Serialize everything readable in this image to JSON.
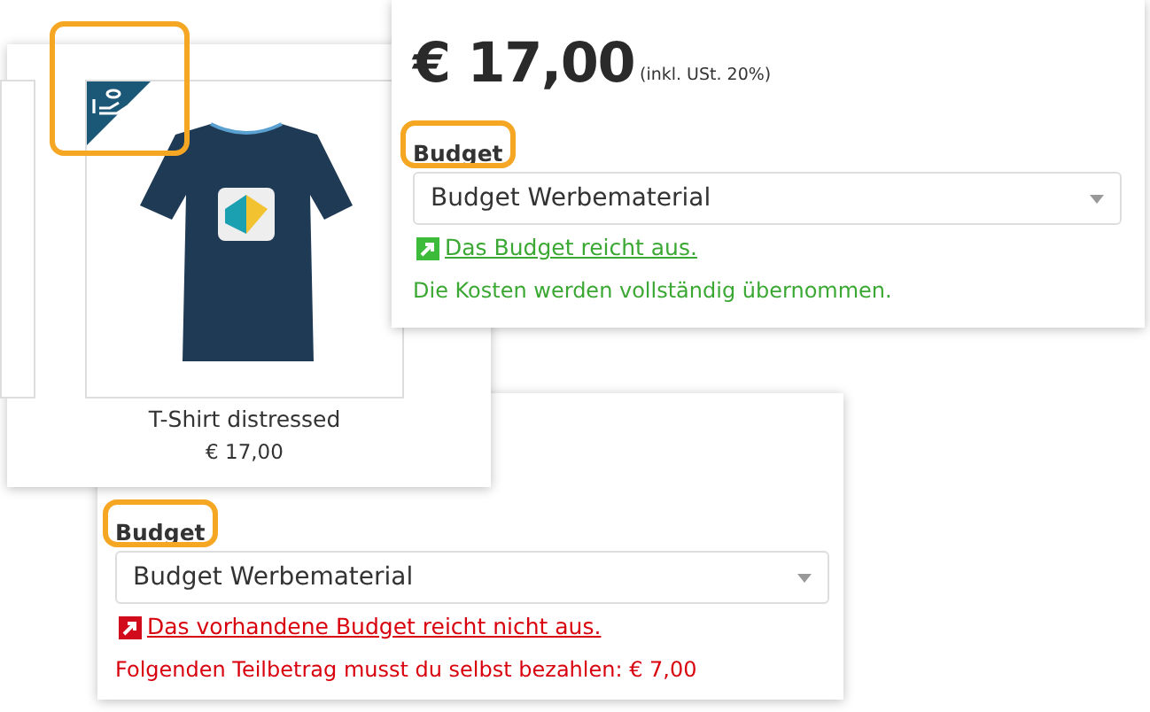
{
  "product_card": {
    "badge_highlighted": true,
    "name": "T-Shirt distressed",
    "price": "€ 17,00"
  },
  "budget_panels": [
    {
      "kind": "sufficient",
      "price": "€ 17,00",
      "tax_note": "(inkl. USt. 20%)",
      "label": "Budget",
      "label_highlighted": true,
      "select_value": "Budget Werbematerial",
      "status_link": "Das Budget reicht aus.",
      "message": "Die Kosten werden vollständig übernommen."
    },
    {
      "kind": "insufficient",
      "label": "Budget",
      "label_highlighted": true,
      "select_value": "Budget Werbematerial",
      "status_link": "Das vorhandene Budget reicht nicht aus.",
      "message": "Folgenden Teilbetrag musst du selbst bezahlen: € 7,00"
    }
  ]
}
